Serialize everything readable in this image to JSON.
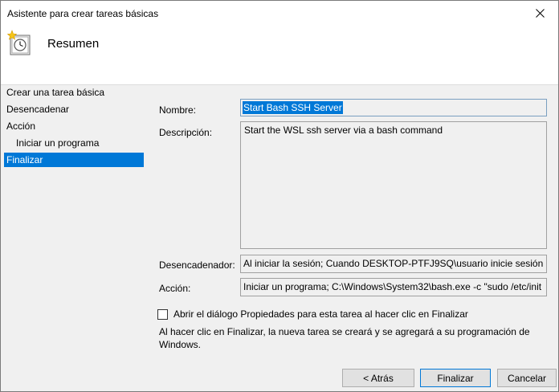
{
  "window": {
    "title": "Asistente para crear tareas básicas"
  },
  "header": {
    "title": "Resumen",
    "icon": "clock-icon"
  },
  "nav": {
    "items": [
      {
        "label": "Crear una tarea básica"
      },
      {
        "label": "Desencadenar"
      },
      {
        "label": "Acción"
      },
      {
        "label": "Iniciar un programa"
      },
      {
        "label": "Finalizar"
      }
    ],
    "active_index": 4
  },
  "form": {
    "name_label": "Nombre:",
    "name_value": "Start Bash SSH Server",
    "description_label": "Descripción:",
    "description_value": "Start the WSL ssh server via a bash command",
    "trigger_label": "Desencadenador:",
    "trigger_value": "Al iniciar la sesión; Cuando DESKTOP-PTFJ9SQ\\usuario inicie sesión",
    "action_label": "Acción:",
    "action_value": "Iniciar un programa; C:\\Windows\\System32\\bash.exe -c \"sudo /etc/init"
  },
  "options": {
    "open_properties_label": "Abrir el diálogo Propiedades para esta tarea al hacer clic en Finalizar",
    "open_properties_checked": false
  },
  "info_text": "Al hacer clic en Finalizar, la nueva tarea se creará y se agregará a su programación de Windows.",
  "buttons": {
    "back": "< Atrás",
    "finish": "Finalizar",
    "cancel": "Cancelar"
  },
  "colors": {
    "accent": "#0078d7",
    "dialog_bg": "#f0f0f0"
  }
}
